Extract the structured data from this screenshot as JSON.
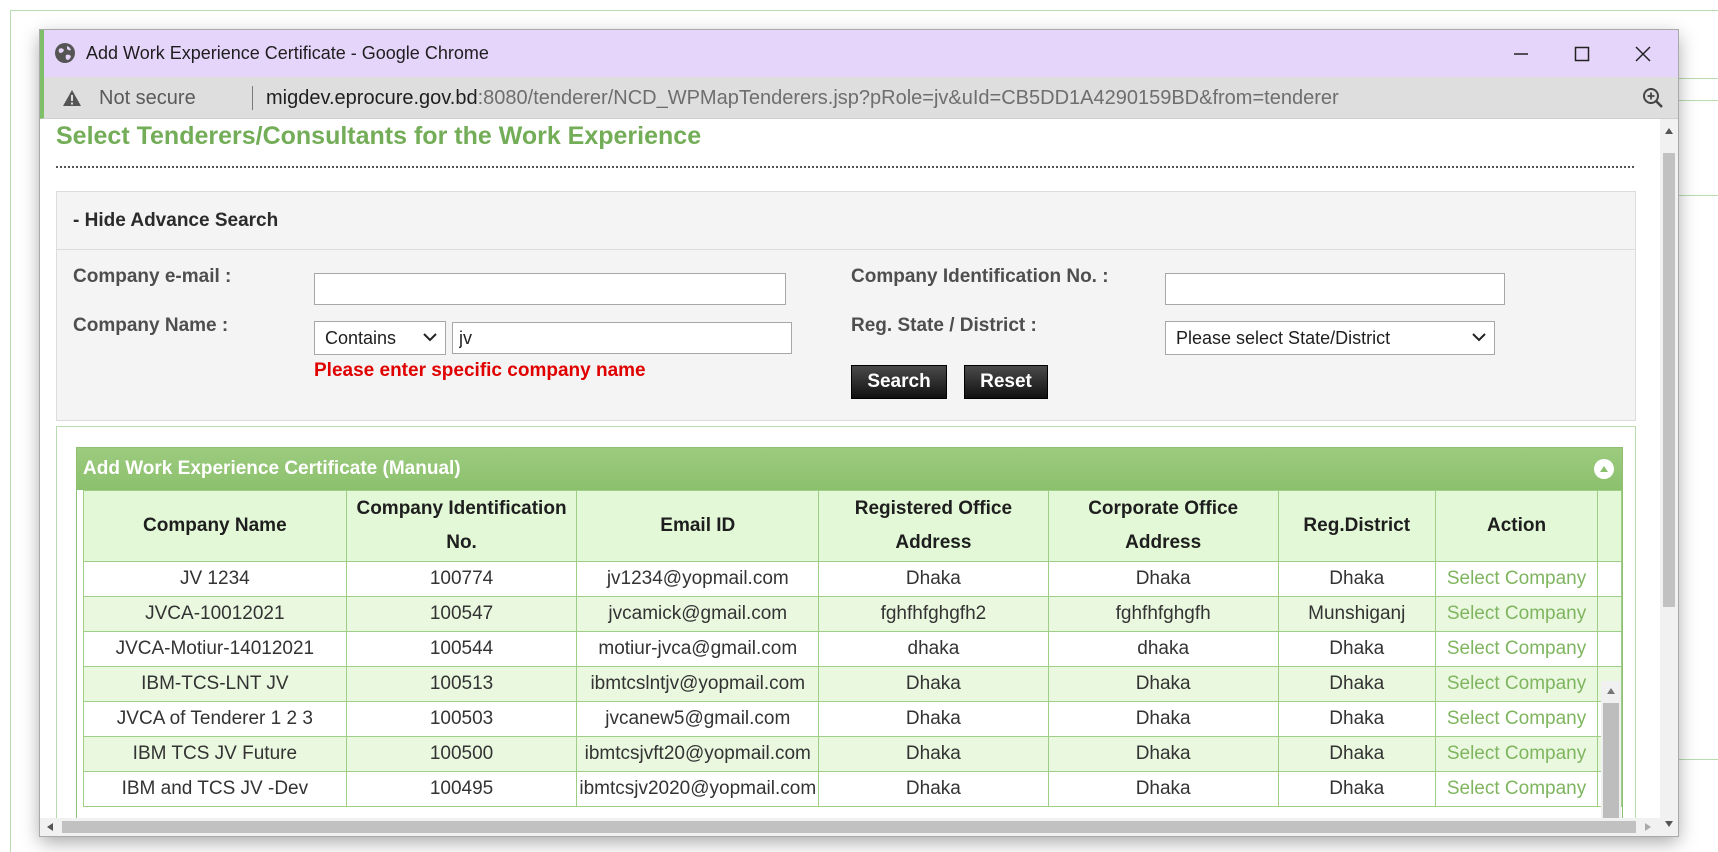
{
  "window": {
    "title": "Add Work Experience Certificate - Google Chrome",
    "not_secure": "Not secure",
    "url_host": "migdev.eprocure.gov.bd",
    "url_rest": ":8080/tenderer/NCD_WPMapTenderers.jsp?pRole=jv&uId=CB5DD1A4290159BD&from=tenderer"
  },
  "page": {
    "title": "Select Tenderers/Consultants for the Work Experience"
  },
  "search": {
    "toggle_label": "- Hide Advance Search",
    "email_label": "Company e-mail :",
    "email_value": "",
    "cin_label": "Company Identification No. :",
    "cin_value": "",
    "name_label": "Company Name :",
    "match_mode": "Contains",
    "name_value": "jv",
    "district_label": "Reg. State / District :",
    "district_selected": "Please select State/District",
    "error": "Please enter specific company name",
    "search_button": "Search",
    "reset_button": "Reset"
  },
  "grid": {
    "caption": "Add Work Experience Certificate (Manual)",
    "columns": [
      "Company Name",
      "Company Identification No.",
      "Email ID",
      "Registered Office Address",
      "Corporate Office Address",
      "Reg.District",
      "Action"
    ],
    "rows": [
      [
        "JV 1234",
        "100774",
        "jv1234@yopmail.com",
        "Dhaka",
        "Dhaka",
        "Dhaka",
        "Select Company"
      ],
      [
        "JVCA-10012021",
        "100547",
        "jvcamick@gmail.com",
        "fghfhfghgfh2",
        "fghfhfghgfh",
        "Munshiganj",
        "Select Company"
      ],
      [
        "JVCA-Motiur-14012021",
        "100544",
        "motiur-jvca@gmail.com",
        "dhaka",
        "dhaka",
        "Dhaka",
        "Select Company"
      ],
      [
        "IBM-TCS-LNT JV",
        "100513",
        "ibmtcslntjv@yopmail.com",
        "Dhaka",
        "Dhaka",
        "Dhaka",
        "Select Company"
      ],
      [
        "JVCA of Tenderer 1 2 3",
        "100503",
        "jvcanew5@gmail.com",
        "Dhaka",
        "Dhaka",
        "Dhaka",
        "Select Company"
      ],
      [
        "IBM TCS JV Future",
        "100500",
        "ibmtcsjvft20@yopmail.com",
        "Dhaka",
        "Dhaka",
        "Dhaka",
        "Select Company"
      ],
      [
        "IBM and TCS JV -Dev",
        "100495",
        "ibmtcsjv2020@yopmail.com",
        "Dhaka",
        "Dhaka",
        "Dhaka",
        "Select Company"
      ]
    ]
  },
  "colors": {
    "accent_green": "#74ad58",
    "header_green": "#8bc06d",
    "row_alt": "#eaf8e0",
    "error_red": "#e00000",
    "titlebar": "#e6d5fb"
  }
}
